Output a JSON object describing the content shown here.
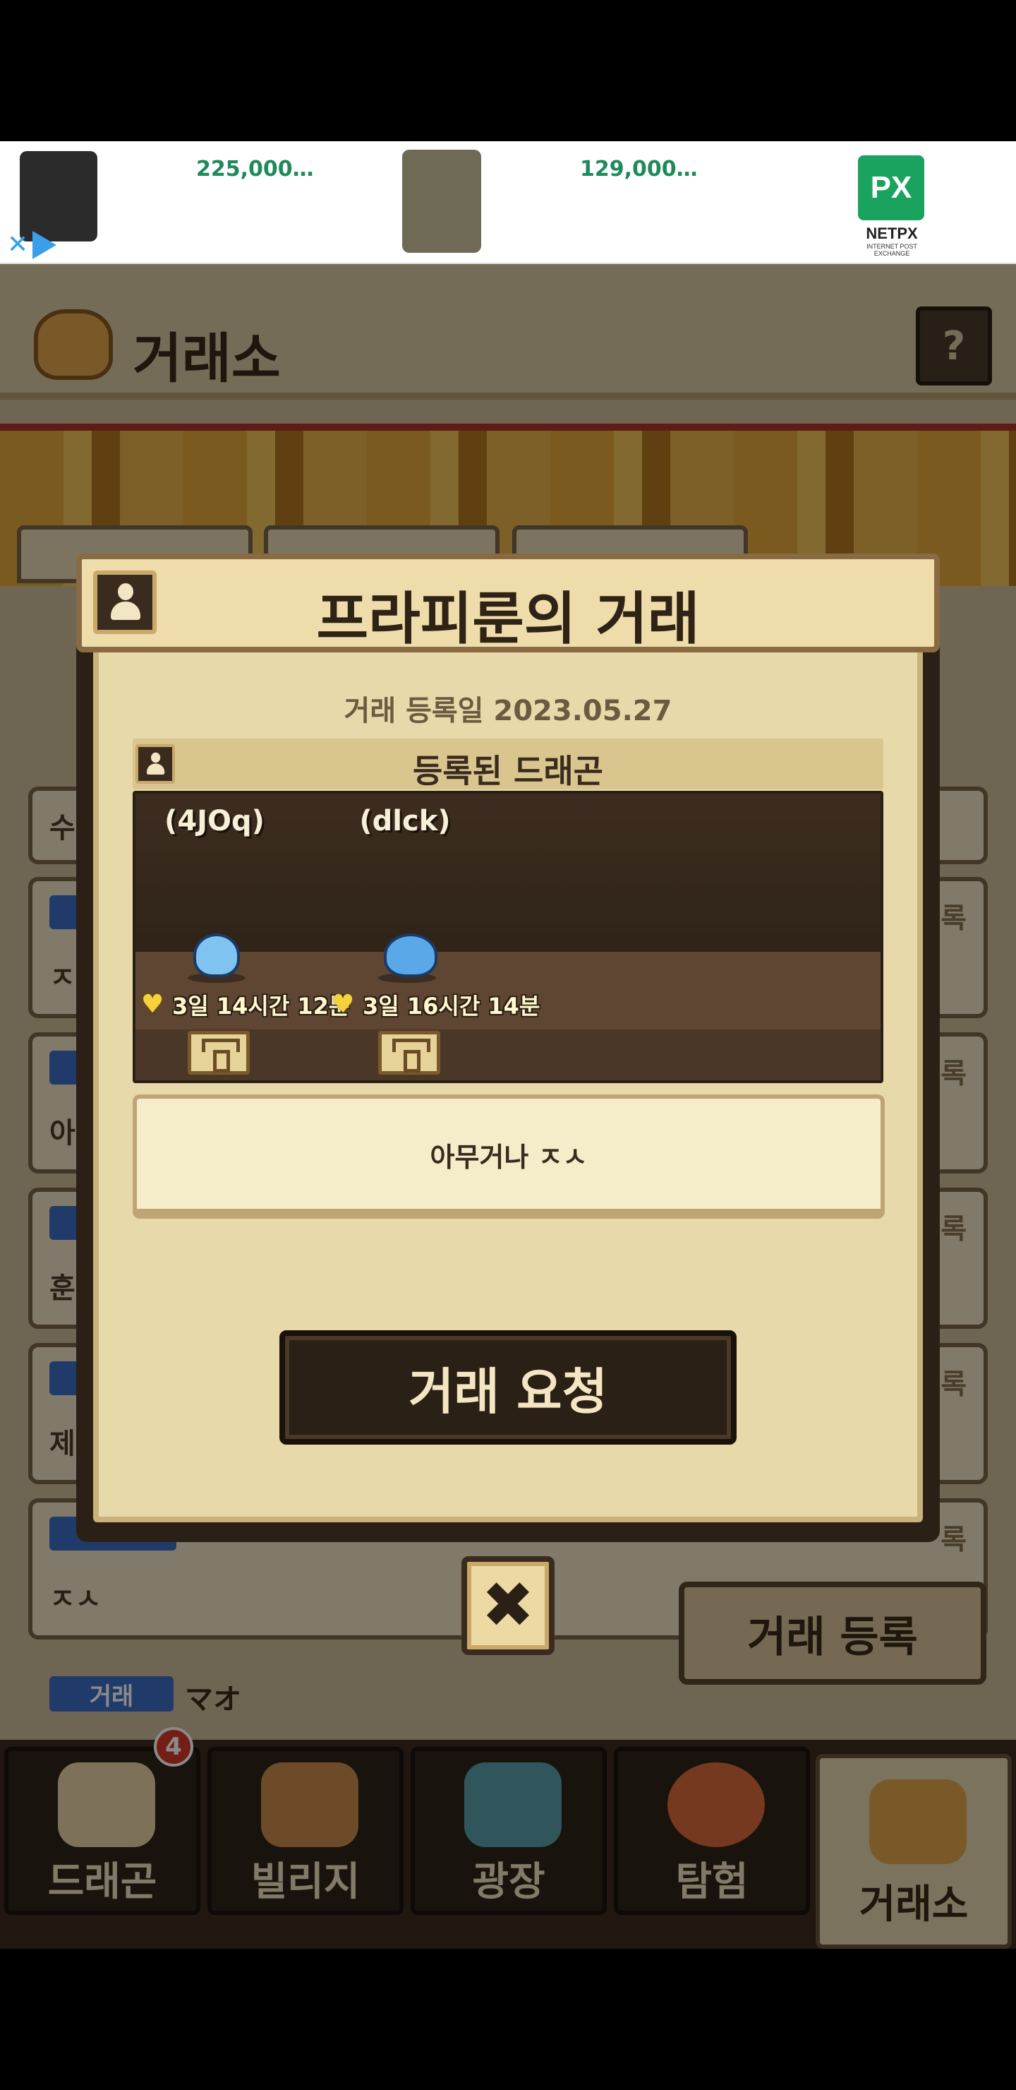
{
  "ad": {
    "price_1": "225,000…",
    "price_2": "129,000…",
    "logo_mark": "PX",
    "logo_name": "NETPX",
    "logo_tagline": "INTERNET POST EXCHANGE",
    "close_icon": "close-x-icon",
    "adchoices_icon": "play-triangle-icon"
  },
  "background": {
    "header_title": "거래소",
    "help_label": "?",
    "register_button": "거래 등록",
    "rows": [
      {
        "text": "수",
        "side": ""
      },
      {
        "text": "ㅈ",
        "side": "록"
      },
      {
        "text": "아",
        "side": "록"
      },
      {
        "text": "훈",
        "side": "록"
      },
      {
        "text": "제",
        "side": "록"
      },
      {
        "text": "ㅈㅅ",
        "side": "록"
      }
    ],
    "trade_tag": "거래",
    "trade_side": "マオ"
  },
  "nav": {
    "items": [
      {
        "label": "드래곤",
        "icon": "dragon-fox-icon",
        "badge": "4"
      },
      {
        "label": "빌리지",
        "icon": "village-house-icon"
      },
      {
        "label": "광장",
        "icon": "plaza-fountain-icon"
      },
      {
        "label": "탐험",
        "icon": "compass-icon"
      },
      {
        "label": "거래소",
        "icon": "scales-icon",
        "active": true
      }
    ]
  },
  "modal": {
    "title": "프라피룬의 거래",
    "registered_date": "거래 등록일 2023.05.27",
    "dragon_section_title": "등록된 드래곤",
    "dragons": [
      {
        "name": "(4JOq)",
        "timer": "3일 14시간 12분",
        "color": "#7fc4f0"
      },
      {
        "name": "(dlck)",
        "timer": "3일 16시간 14분",
        "color": "#5aa8e8"
      }
    ],
    "message": "아무거나 ㅈㅅ",
    "request_button": "거래 요청",
    "close_button": "✖"
  }
}
